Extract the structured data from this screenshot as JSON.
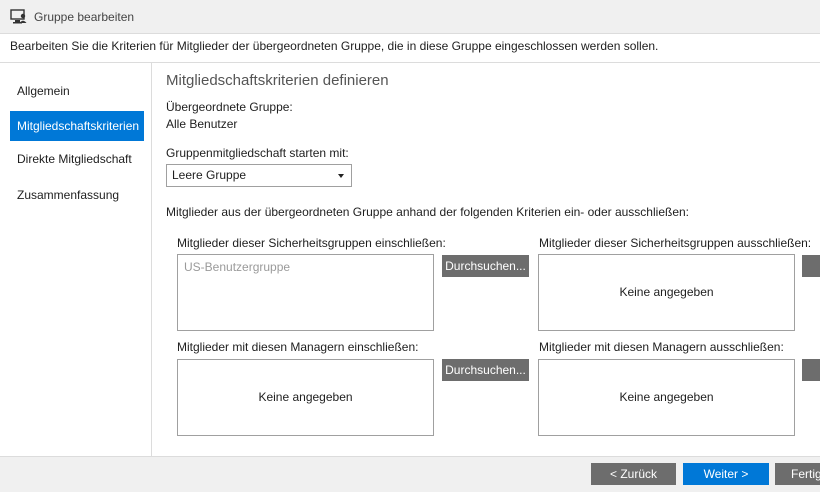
{
  "window": {
    "title": "Gruppe bearbeiten",
    "icon": "computer-user-icon"
  },
  "subtitle": "Bearbeiten Sie die Kriterien für Mitglieder der übergeordneten Gruppe, die in diese Gruppe eingeschlossen werden sollen.",
  "nav": {
    "items": [
      {
        "label": "Allgemein"
      },
      {
        "label": "Mitgliedschaftskriterien"
      },
      {
        "label": "Direkte Mitgliedschaft"
      },
      {
        "label": "Zusammenfassung"
      }
    ],
    "active": "Mitgliedschaftskriterien"
  },
  "main": {
    "heading": "Mitgliedschaftskriterien definieren",
    "parent_label": "Übergeordnete Gruppe:",
    "parent_value": "Alle Benutzer",
    "start_label": "Gruppenmitgliedschaft starten mit:",
    "start_value": "Leere Gruppe",
    "criteria_intro": "Mitglieder aus der übergeordneten Gruppe anhand der folgenden Kriterien ein- oder ausschließen:",
    "include_groups_label": "Mitglieder dieser Sicherheitsgruppen einschließen:",
    "include_groups_item": "US-Benutzergruppe",
    "exclude_groups_label": "Mitglieder dieser Sicherheitsgruppen ausschließen:",
    "exclude_groups_empty": "Keine angegeben",
    "include_managers_label": "Mitglieder mit diesen Managern einschließen:",
    "include_managers_empty": "Keine angegeben",
    "exclude_managers_label": "Mitglieder mit diesen Managern ausschließen:",
    "exclude_managers_empty": "Keine angegeben",
    "browse_label": "Durchsuchen..."
  },
  "footer": {
    "back_label": "< Zurück",
    "next_label": "Weiter >",
    "finish_label": "Fertig"
  },
  "colors": {
    "accent": "#0078d7",
    "button_gray": "#6d6d6d",
    "chrome": "#f0f0f0"
  }
}
